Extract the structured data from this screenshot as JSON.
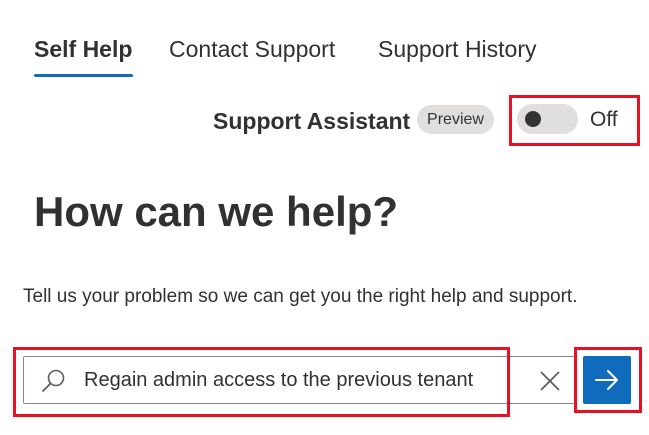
{
  "tabs": [
    {
      "label": "Self Help",
      "active": true
    },
    {
      "label": "Contact Support",
      "active": false
    },
    {
      "label": "Support History",
      "active": false
    }
  ],
  "assistant": {
    "label": "Support Assistant",
    "badge": "Preview",
    "toggle_state": "Off"
  },
  "main": {
    "title": "How can we help?",
    "intro": "Tell us your problem so we can get you the right help and support."
  },
  "search": {
    "value": "Regain admin access to the previous tenant",
    "icon": "search-icon",
    "clear_icon": "close-icon",
    "submit_icon": "arrow-right-icon"
  },
  "colors": {
    "accent": "#0f6cbd",
    "highlight": "#e81123",
    "text": "#323130",
    "badge_bg": "#e1dfdd"
  }
}
